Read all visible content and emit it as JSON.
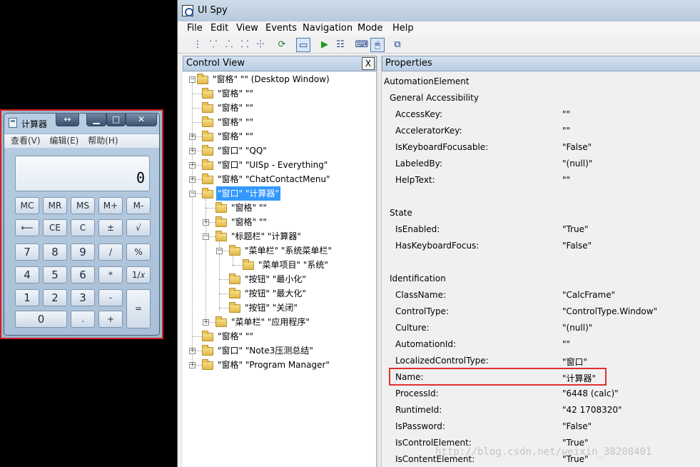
{
  "calculator": {
    "title": "计算器",
    "display": "0",
    "menu": [
      "查看(V)",
      "编辑(E)",
      "帮助(H)"
    ],
    "title_buttons": {
      "resize": "↔",
      "minimize": "▁",
      "maximize": "□",
      "close": "✕"
    },
    "keys": {
      "mc": "MC",
      "mr": "MR",
      "ms": "MS",
      "mplus": "M+",
      "mminus": "M-",
      "back": "⟵",
      "ce": "CE",
      "c": "C",
      "plusminus": "±",
      "sqrt": "√",
      "k7": "7",
      "k8": "8",
      "k9": "9",
      "div": "/",
      "pct": "%",
      "k4": "4",
      "k5": "5",
      "k6": "6",
      "mul": "*",
      "recip": "1/𝑥",
      "k1": "1",
      "k2": "2",
      "k3": "3",
      "sub": "-",
      "eq": "=",
      "k0": "0",
      "dot": ".",
      "add": "+"
    }
  },
  "uispy": {
    "title": "UI Spy",
    "menu": [
      "File",
      "Edit",
      "View",
      "Events",
      "Navigation",
      "Mode",
      "Help"
    ],
    "control_view_title": "Control View",
    "close_label": "X",
    "properties_title": "Properties",
    "tree": [
      {
        "text": "\"窗格\" \"\" (Desktop Window)",
        "level": 0,
        "exp": "-"
      },
      {
        "text": "\"窗格\" \"\"",
        "level": 1,
        "exp": ""
      },
      {
        "text": "\"窗格\" \"\"",
        "level": 1,
        "exp": ""
      },
      {
        "text": "\"窗格\" \"\"",
        "level": 1,
        "exp": ""
      },
      {
        "text": "\"窗格\" \"\"",
        "level": 1,
        "exp": "+"
      },
      {
        "text": "\"窗口\" \"QQ\"",
        "level": 1,
        "exp": "+"
      },
      {
        "text": "\"窗口\" \"UISp - Everything\"",
        "level": 1,
        "exp": "+"
      },
      {
        "text": "\"窗格\" \"ChatContactMenu\"",
        "level": 1,
        "exp": "+"
      },
      {
        "text": "\"窗口\" \"计算器\"",
        "level": 1,
        "exp": "-",
        "selected": true
      },
      {
        "text": "\"窗格\" \"\"",
        "level": 2,
        "exp": ""
      },
      {
        "text": "\"窗格\" \"\"",
        "level": 2,
        "exp": "+"
      },
      {
        "text": "\"标题栏\" \"计算器\"",
        "level": 2,
        "exp": "-"
      },
      {
        "text": "\"菜单栏\" \"系统菜单栏\"",
        "level": 3,
        "exp": "-"
      },
      {
        "text": "\"菜单项目\" \"系统\"",
        "level": 4,
        "exp": ""
      },
      {
        "text": "\"按钮\" \"最小化\"",
        "level": 3,
        "exp": ""
      },
      {
        "text": "\"按钮\" \"最大化\"",
        "level": 3,
        "exp": ""
      },
      {
        "text": "\"按钮\" \"关闭\"",
        "level": 3,
        "exp": ""
      },
      {
        "text": "\"菜单栏\" \"应用程序\"",
        "level": 2,
        "exp": "+"
      },
      {
        "text": "\"窗格\" \"\"",
        "level": 1,
        "exp": ""
      },
      {
        "text": "\"窗口\" \"Note3压测总结\"",
        "level": 1,
        "exp": "+"
      },
      {
        "text": "\"窗格\" \"Program Manager\"",
        "level": 1,
        "exp": "+"
      }
    ],
    "properties": [
      {
        "type": "section0",
        "label": "AutomationElement"
      },
      {
        "type": "section",
        "label": "General Accessibility"
      },
      {
        "type": "prop",
        "label": "AccessKey:",
        "value": "\"\""
      },
      {
        "type": "prop",
        "label": "AcceleratorKey:",
        "value": "\"\""
      },
      {
        "type": "prop",
        "label": "IsKeyboardFocusable:",
        "value": "\"False\""
      },
      {
        "type": "prop",
        "label": "LabeledBy:",
        "value": "\"(null)\""
      },
      {
        "type": "prop",
        "label": "HelpText:",
        "value": "\"\""
      },
      {
        "type": "gap"
      },
      {
        "type": "section",
        "label": "State"
      },
      {
        "type": "prop",
        "label": "IsEnabled:",
        "value": "\"True\""
      },
      {
        "type": "prop",
        "label": "HasKeyboardFocus:",
        "value": "\"False\""
      },
      {
        "type": "gap"
      },
      {
        "type": "section",
        "label": "Identification"
      },
      {
        "type": "prop",
        "label": "ClassName:",
        "value": "\"CalcFrame\""
      },
      {
        "type": "prop",
        "label": "ControlType:",
        "value": "\"ControlType.Window\""
      },
      {
        "type": "prop",
        "label": "Culture:",
        "value": "\"(null)\""
      },
      {
        "type": "prop",
        "label": "AutomationId:",
        "value": "\"\""
      },
      {
        "type": "prop",
        "label": "LocalizedControlType:",
        "value": "\"窗口\""
      },
      {
        "type": "prop",
        "label": "Name:",
        "value": "\"计算器\""
      },
      {
        "type": "prop",
        "label": "ProcessId:",
        "value": "\"6448 (calc)\""
      },
      {
        "type": "prop",
        "label": "RuntimeId:",
        "value": "\"42 1708320\""
      },
      {
        "type": "prop",
        "label": "IsPassword:",
        "value": "\"False\""
      },
      {
        "type": "prop",
        "label": "IsControlElement:",
        "value": "\"True\""
      },
      {
        "type": "prop",
        "label": "IsContentElement:",
        "value": "\"True\""
      }
    ]
  },
  "watermark": "http://blog.csdn.net/weixin_38208401"
}
